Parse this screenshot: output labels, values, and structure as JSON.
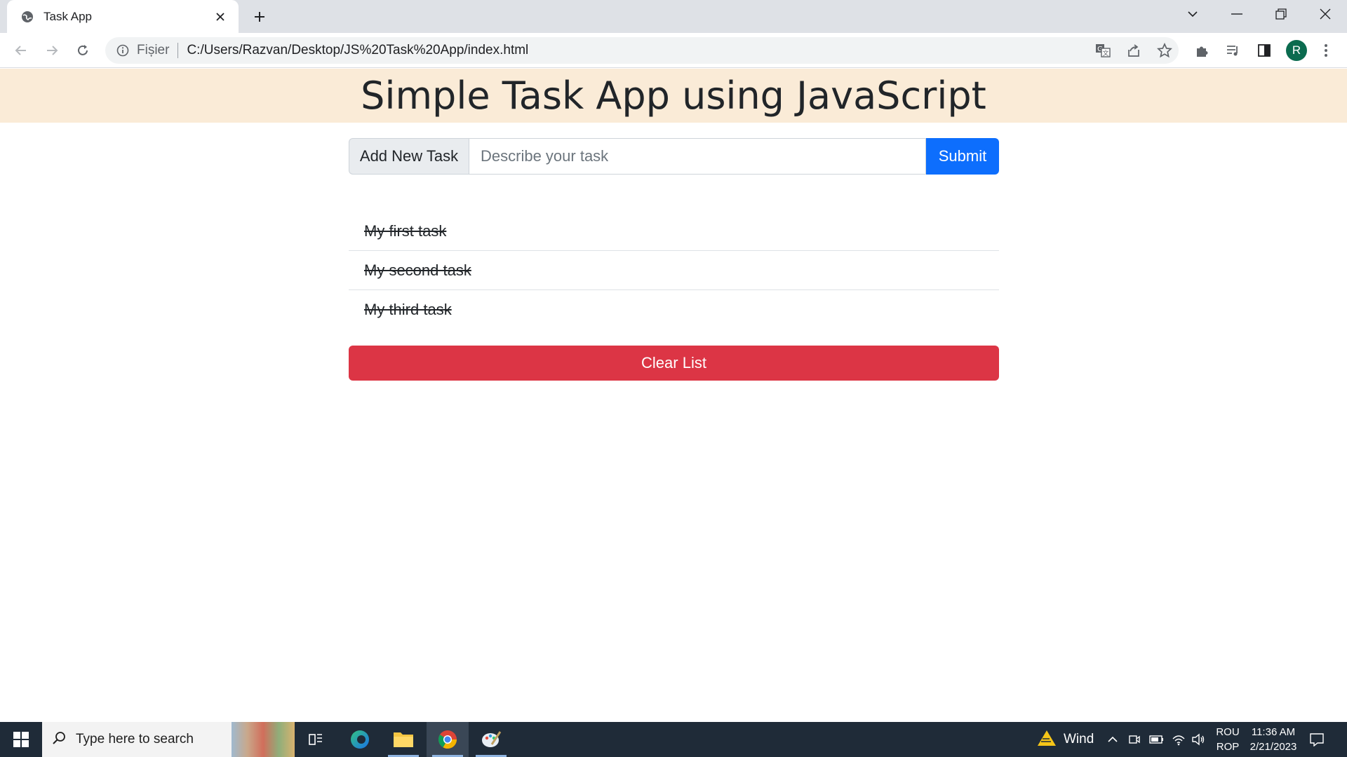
{
  "browser": {
    "tab_title": "Task App",
    "omnibox_scheme": "Fișier",
    "url": "C:/Users/Razvan/Desktop/JS%20Task%20App/index.html",
    "profile_initial": "R"
  },
  "page": {
    "title": "Simple Task App using JavaScript",
    "add_label": "Add New Task",
    "input_placeholder": "Describe your task",
    "input_value": "",
    "submit_label": "Submit",
    "tasks": [
      {
        "text": "My first task",
        "done": true
      },
      {
        "text": "My second task",
        "done": true
      },
      {
        "text": "My third task",
        "done": true
      }
    ],
    "clear_label": "Clear List"
  },
  "taskbar": {
    "search_placeholder": "Type here to search",
    "weather": "Wind",
    "lang_top": "ROU",
    "lang_bottom": "ROP",
    "time": "11:36 AM",
    "date": "2/21/2023"
  },
  "colors": {
    "header_bg": "#faebd7",
    "submit_bg": "#0d6efd",
    "clear_bg": "#dc3545",
    "taskbar_bg": "#1f2b38"
  }
}
